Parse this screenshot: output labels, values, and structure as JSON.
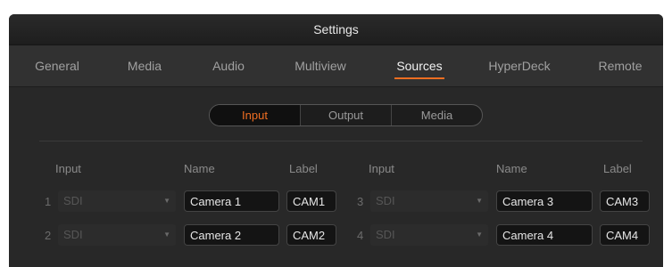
{
  "window": {
    "title": "Settings"
  },
  "tabs": [
    {
      "label": "General"
    },
    {
      "label": "Media"
    },
    {
      "label": "Audio"
    },
    {
      "label": "Multiview"
    },
    {
      "label": "Sources",
      "active": true
    },
    {
      "label": "HyperDeck"
    },
    {
      "label": "Remote"
    }
  ],
  "source_toggle": {
    "options": [
      {
        "label": "Input",
        "active": true
      },
      {
        "label": "Output"
      },
      {
        "label": "Media"
      }
    ]
  },
  "columns": {
    "left": {
      "input": "Input",
      "name": "Name",
      "label": "Label"
    },
    "right": {
      "input": "Input",
      "name": "Name",
      "label": "Label"
    }
  },
  "inputs": [
    {
      "number": "1",
      "type": "SDI",
      "name": "Camera 1",
      "label": "CAM1"
    },
    {
      "number": "2",
      "type": "SDI",
      "name": "Camera 2",
      "label": "CAM2"
    },
    {
      "number": "3",
      "type": "SDI",
      "name": "Camera 3",
      "label": "CAM3"
    },
    {
      "number": "4",
      "type": "SDI",
      "name": "Camera 4",
      "label": "CAM4"
    }
  ],
  "colors": {
    "accent": "#f06e22",
    "panel": "#282828",
    "titlebar": "#1e1e1e"
  }
}
